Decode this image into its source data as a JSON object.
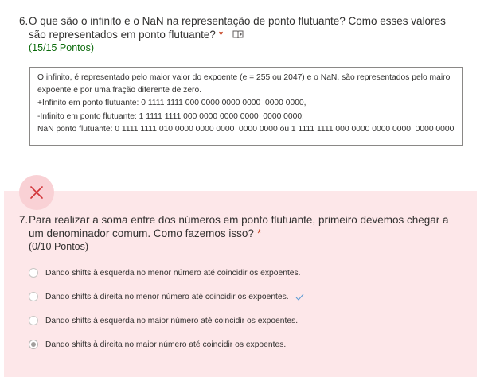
{
  "q6": {
    "number": "6.",
    "text": "O que são o infinito e o NaN na representação de ponto flutuante? Como esses valores são representados em ponto flutuante?",
    "required": "*",
    "points": "(15/15 Pontos)",
    "answer_lines": [
      "O infinito, é representado pelo maior valor do expoente (e = 255 ou 2047) e o NaN, são representados pelo mairo expoente e por uma fração diferente de zero.",
      "+Infinito em ponto flutuante: 0 1111 1111 000 0000 0000 0000  0000 0000,",
      "-Infinito em ponto flutuante: 1 1111 1111 000 0000 0000 0000  0000 0000;",
      "NaN ponto flutuante: 0 1111 1111 010 0000 0000 0000  0000 0000 ou 1 1111 1111 000 0000 0000 0000  0000 0000"
    ]
  },
  "q7": {
    "number": "7.",
    "text": "Para realizar a soma entre dos números em ponto flutuante, primeiro devemos chegar a um denominador comum. Como fazemos isso?",
    "required": "*",
    "points": "(0/10 Pontos)",
    "options": [
      {
        "label": "Dando shifts à esquerda no menor número até coincidir os expoentes.",
        "selected": false,
        "correct": false
      },
      {
        "label": "Dando shifts à direita no menor número até coincidir os expoentes.",
        "selected": false,
        "correct": true
      },
      {
        "label": "Dando shifts à esquerda no maior número até coincidir os expoentes.",
        "selected": false,
        "correct": false
      },
      {
        "label": "Dando shifts à direita no maior número até coincidir os expoentes.",
        "selected": true,
        "correct": false
      }
    ]
  },
  "colors": {
    "required": "#c43e1c",
    "points_correct": "#0b6a0b",
    "wrong_bg": "#fde7e9",
    "wrong_icon": "#d13438",
    "check": "#5b9bd5"
  },
  "icons": {
    "immersive_reader": "immersive-reader-icon",
    "wrong": "close-icon",
    "correct": "check-icon"
  }
}
